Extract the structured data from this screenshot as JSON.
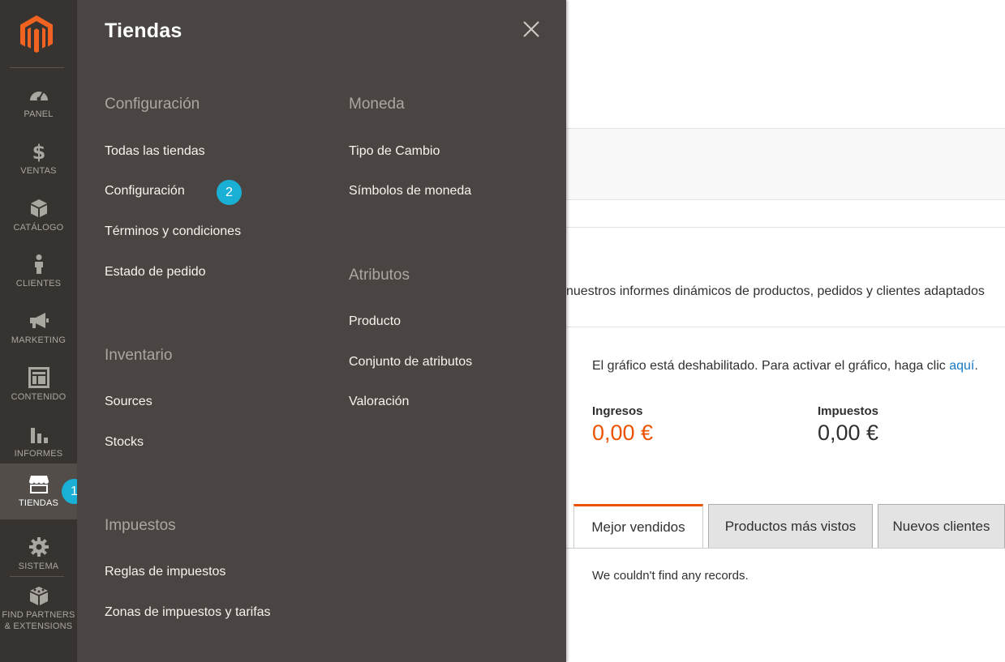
{
  "colors": {
    "sidebar_bg": "#373330",
    "flyout_bg": "#4a4542",
    "accent_orange": "#eb5202",
    "badge_blue": "#1ab0d6",
    "link_blue": "#1979c3"
  },
  "sidebar": {
    "items": [
      {
        "label": "PANEL",
        "icon": "gauge-icon"
      },
      {
        "label": "VENTAS",
        "icon": "dollar-icon"
      },
      {
        "label": "CATÁLOGO",
        "icon": "box-icon"
      },
      {
        "label": "CLIENTES",
        "icon": "person-icon"
      },
      {
        "label": "MARKETING",
        "icon": "megaphone-icon"
      },
      {
        "label": "CONTENIDO",
        "icon": "layout-icon"
      },
      {
        "label": "INFORMES",
        "icon": "bar-chart-icon"
      },
      {
        "label": "TIENDAS",
        "icon": "store-icon"
      },
      {
        "label": "SISTEMA",
        "icon": "gear-icon"
      },
      {
        "label_line1": "FIND PARTNERS",
        "label_line2": "& EXTENSIONS",
        "icon": "cube-icon"
      }
    ],
    "badge": "1"
  },
  "flyout": {
    "title": "Tiendas",
    "close_icon": "close-icon",
    "badge": "2",
    "groups": {
      "configuracion": {
        "heading": "Configuración",
        "items": [
          "Todas las tiendas",
          "Configuración",
          "Términos y condiciones",
          "Estado de pedido"
        ]
      },
      "inventario": {
        "heading": "Inventario",
        "items": [
          "Sources",
          "Stocks"
        ]
      },
      "impuestos": {
        "heading": "Impuestos",
        "items": [
          "Reglas de impuestos",
          "Zonas de impuestos y tarifas"
        ]
      },
      "moneda": {
        "heading": "Moneda",
        "items": [
          "Tipo de Cambio",
          "Símbolos de moneda"
        ]
      },
      "atributos": {
        "heading": "Atributos",
        "items": [
          "Producto",
          "Conjunto de atributos",
          "Valoración"
        ]
      }
    }
  },
  "main": {
    "description": "nuestros informes dinámicos de productos, pedidos y clientes adaptados",
    "chart_message": "El gráfico está deshabilitado. Para activar el gráfico, haga clic ",
    "chart_link": "aquí",
    "chart_message_end": ".",
    "revenue_label": "Ingresos",
    "revenue_value": "0,00 €",
    "tax_label": "Impuestos",
    "tax_value": "0,00 €",
    "tabs": [
      "Mejor vendidos",
      "Productos más vistos",
      "Nuevos clientes"
    ],
    "no_records": "We couldn't find any records."
  }
}
